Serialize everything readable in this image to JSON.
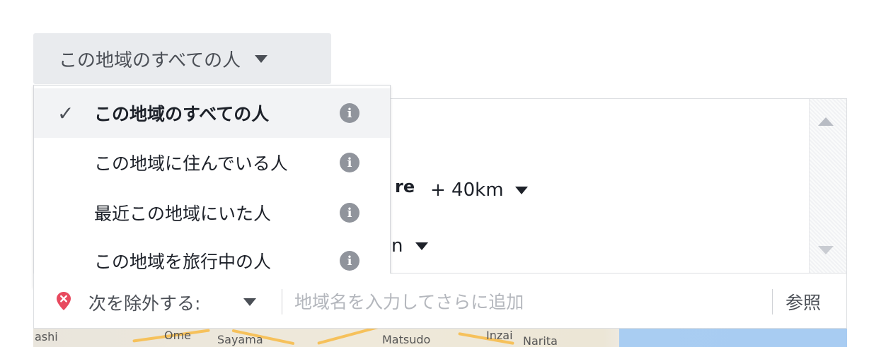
{
  "audience_dropdown": {
    "selected_label": "この地域のすべての人",
    "options": [
      {
        "label": "この地域のすべての人",
        "selected": true
      },
      {
        "label": "この地域に住んでいる人",
        "selected": false
      },
      {
        "label": "最近この地域にいた人",
        "selected": false
      },
      {
        "label": "この地域を旅行中の人",
        "selected": false
      }
    ],
    "check_glyph": "✓",
    "info_glyph": "i"
  },
  "location_panel": {
    "name_fragment": "re",
    "radius": "+ 40km",
    "unit_fragment": "n"
  },
  "exclude": {
    "label": "次を除外する:",
    "input_placeholder": "地域名を入力してさらに追加",
    "input_value": "",
    "browse_label": "参照"
  },
  "map": {
    "labels": [
      "ashi",
      "Ome",
      "Sayama",
      "Matsudo",
      "Inzai",
      "Narita"
    ]
  },
  "colors": {
    "button_bg": "#e9ebee",
    "selected_bg": "#f2f3f5",
    "info_icon": "#90949c",
    "pin_red": "#e84a5f",
    "placeholder": "#b4b7bd"
  }
}
